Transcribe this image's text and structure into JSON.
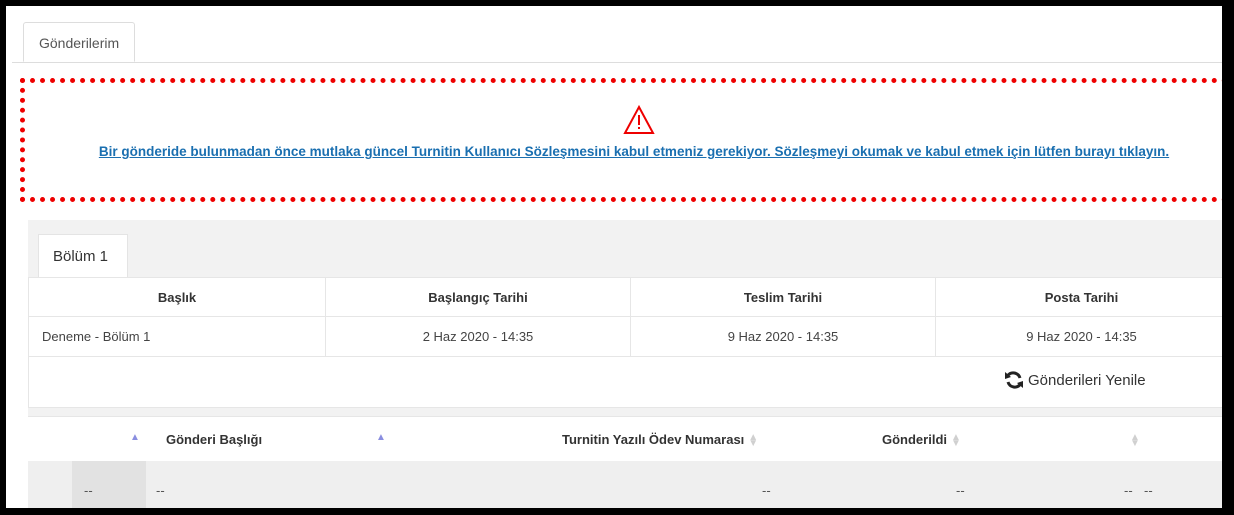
{
  "tabs": {
    "active_label": "Gönderilerim"
  },
  "notice": {
    "icon": "warning-icon",
    "link_text": "Bir gönderide bulunmadan önce mutlaka güncel Turnitin Kullanıcı Sözleşmesini kabul etmeniz gerekiyor. Sözleşmeyi okumak ve kabul etmek için lütfen burayı tıklayın."
  },
  "section": {
    "tab_label": "Bölüm 1"
  },
  "info_table": {
    "headers": [
      "Başlık",
      "Başlangıç Tarihi",
      "Teslim Tarihi",
      "Posta Tarihi"
    ],
    "row": [
      "Deneme - Bölüm 1",
      "2 Haz 2020 - 14:35",
      "9 Haz 2020 - 14:35",
      "9 Haz 2020 - 14:35"
    ]
  },
  "refresh": {
    "label": "Gönderileri Yenile",
    "icon": "refresh-icon"
  },
  "submissions": {
    "headers": [
      "Gönderi Başlığı",
      "Turnitin Yazılı Ödev Numarası",
      "Gönderildi"
    ],
    "row": [
      "--",
      "--",
      "--",
      "--",
      "--",
      "--"
    ]
  },
  "colors": {
    "alert_border": "#e00000",
    "link": "#1a6fb0",
    "sort_active": "#8a8ee0"
  }
}
